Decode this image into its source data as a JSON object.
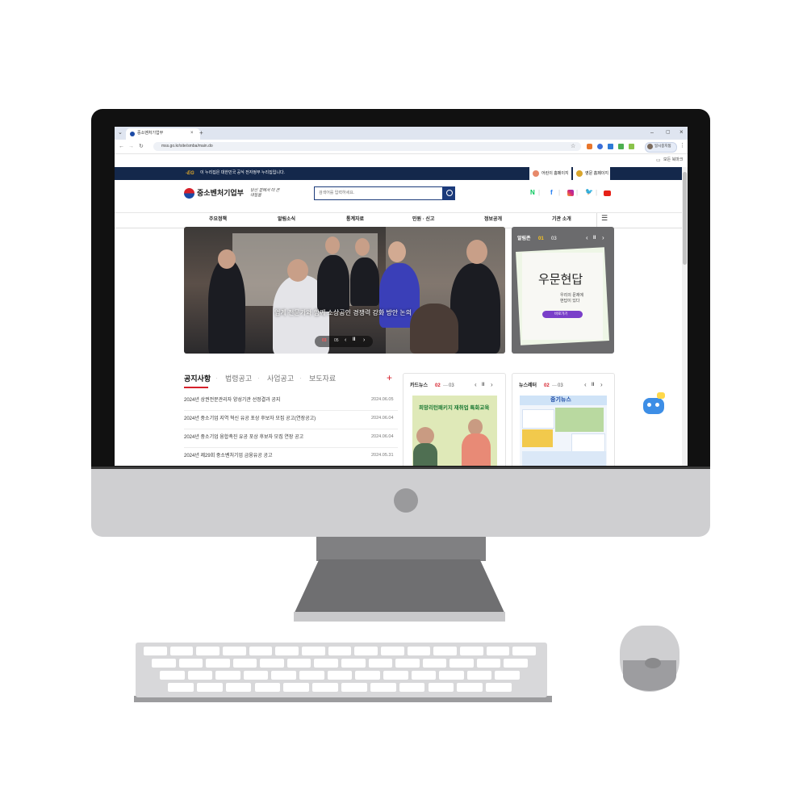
{
  "browser": {
    "tab_title": "중소벤처기업부",
    "url": "mss.go.kr/site/smba/main.do",
    "profile_label": "일시중지됨",
    "bookmark_label": "모든 북마크"
  },
  "govbar": {
    "notice": "이 누리집은 대한민국 공식 전자정부 누리집입니다.",
    "kids_label": "어린이 홈페이지",
    "english_label": "영문 홈페이지"
  },
  "header": {
    "site_name": "중소벤처기업부",
    "slogan": "당신 곁에서 더 큰 내일을",
    "search_placeholder": "검색어를 입력하세요."
  },
  "nav": {
    "items": [
      "주요정책",
      "알림소식",
      "통계자료",
      "민원 · 신고",
      "정보공개",
      "기관 소개"
    ]
  },
  "hero": {
    "caption": "업계 전문가와 함께 소상공인 경쟁력 강화 방안 논의",
    "current": "03",
    "total": "05"
  },
  "alimzone": {
    "title": "알림존",
    "current": "01",
    "total": "03",
    "card_title": "우문현답",
    "card_subtitle": "우리의 문제에\n현답이 있다",
    "button": "바로가기"
  },
  "notices": {
    "tabs": [
      "공지사항",
      "법령공고",
      "사업공고",
      "보도자료"
    ],
    "items": [
      {
        "title": "2024년 상권전문관리자 양성기관 선정결과 공지",
        "date": "2024.06.05"
      },
      {
        "title": "2024년 중소기업 지역 혁신 유공 포상 후보자 모집 공고(연장공고)",
        "date": "2024.06.04"
      },
      {
        "title": "2024년 중소기업 융합촉진 유공 포상 후보자 모집 연장 공고",
        "date": "2024.06.04"
      },
      {
        "title": "2024년 제29회 중소벤처기업 금융유공 공고",
        "date": "2024.05.31"
      }
    ]
  },
  "cardnews": {
    "title": "카드뉴스",
    "current": "02",
    "total": "03",
    "headline": "희망리턴패키지 재취업 특화교육"
  },
  "newsletter": {
    "title": "뉴스레터",
    "current": "02",
    "total": "03",
    "banner": "중기뉴스"
  },
  "colors": {
    "gov_navy": "#14284b",
    "accent_red": "#d6202b",
    "purple": "#7a3fc9",
    "monitor_bezel": "#111111"
  }
}
